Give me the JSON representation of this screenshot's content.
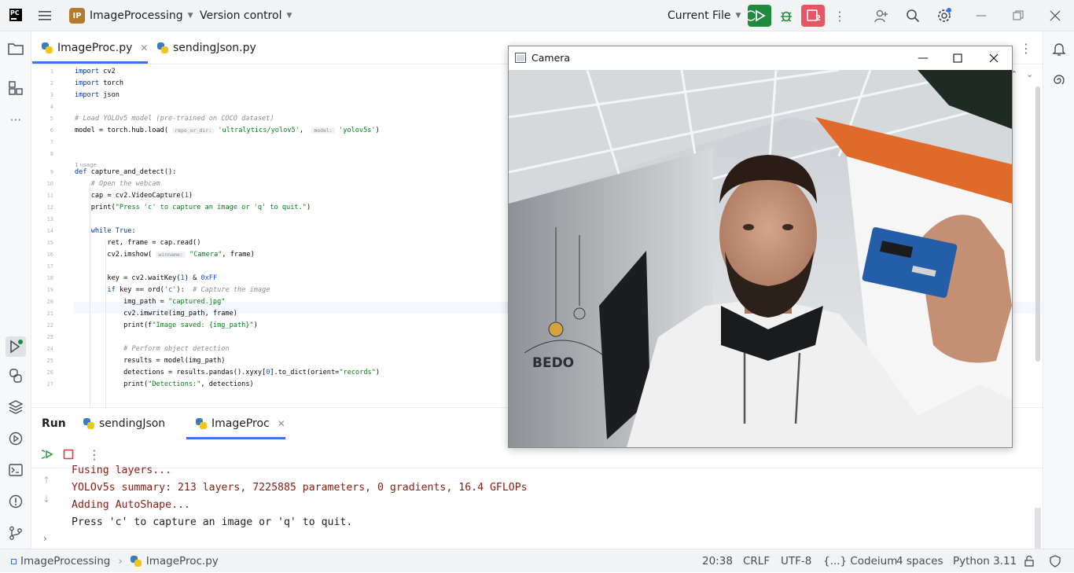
{
  "titlebar": {
    "app_logo": "PC",
    "project_badge": "IP",
    "project_name": "ImageProcessing",
    "vcs_label": "Version control",
    "run_config": "Current File",
    "stop_badge": "2"
  },
  "editor_tabs": [
    {
      "label": "ImageProc.py",
      "active": true
    },
    {
      "label": "sendingJson.py",
      "active": false
    }
  ],
  "code_lines": [
    {
      "n": "1",
      "text": "import cv2"
    },
    {
      "n": "2",
      "text": "import torch"
    },
    {
      "n": "3",
      "text": "import json"
    },
    {
      "n": "4",
      "text": ""
    },
    {
      "n": "5",
      "text": "# Load YOLOv5 model (pre-trained on COCO dataset)"
    },
    {
      "n": "6",
      "text": "model = torch.hub.load( repo_or_dir: 'ultralytics/yolov5',  model: 'yolov5s')"
    },
    {
      "n": "7",
      "text": ""
    },
    {
      "n": "8",
      "text": ""
    },
    {
      "n": "9",
      "text": "def capture_and_detect():"
    },
    {
      "n": "10",
      "text": "    # Open the webcam"
    },
    {
      "n": "11",
      "text": "    cap = cv2.VideoCapture(1)"
    },
    {
      "n": "12",
      "text": "    print(\"Press 'c' to capture an image or 'q' to quit.\")"
    },
    {
      "n": "13",
      "text": ""
    },
    {
      "n": "14",
      "text": "    while True:"
    },
    {
      "n": "15",
      "text": "        ret, frame = cap.read()"
    },
    {
      "n": "16",
      "text": "        cv2.imshow( winname: \"Camera\", frame)"
    },
    {
      "n": "17",
      "text": ""
    },
    {
      "n": "18",
      "text": "        key = cv2.waitKey(1) & 0xFF"
    },
    {
      "n": "19",
      "text": "        if key == ord('c'):  # Capture the image"
    },
    {
      "n": "20",
      "text": "            img_path = \"captured.jpg\""
    },
    {
      "n": "21",
      "text": "            cv2.imwrite(img_path, frame)"
    },
    {
      "n": "22",
      "text": "            print(f\"Image saved: {img_path}\")"
    },
    {
      "n": "23",
      "text": ""
    },
    {
      "n": "24",
      "text": "            # Perform object detection"
    },
    {
      "n": "25",
      "text": "            results = model(img_path)"
    },
    {
      "n": "26",
      "text": "            detections = results.pandas().xyxy[0].to_dict(orient=\"records\")"
    },
    {
      "n": "27",
      "text": "            print(\"Detections:\", detections)"
    }
  ],
  "usage_hint": "1 usage",
  "inlay_hints": {
    "repo": "repo_or_dir:",
    "model": "model:",
    "winname": "winname:"
  },
  "run_panel": {
    "title": "Run",
    "tabs": [
      {
        "label": "sendingJson",
        "active": false
      },
      {
        "label": "ImageProc",
        "active": true
      }
    ],
    "console": [
      {
        "text": "Fusing layers...",
        "type": "err"
      },
      {
        "text": "YOLOv5s summary: 213 layers, 7225885 parameters, 0 gradients, 16.4 GFLOPs",
        "type": "err"
      },
      {
        "text": "Adding AutoShape...",
        "type": "err"
      },
      {
        "text": "Press 'c' to capture an image or 'q' to quit.",
        "type": "out"
      }
    ]
  },
  "statusbar": {
    "breadcrumb_project": "ImageProcessing",
    "breadcrumb_file": "ImageProc.py",
    "caret": "20:38",
    "line_sep": "CRLF",
    "encoding": "UTF-8",
    "plugin": "{...} Codeium",
    "indent": "4 spaces",
    "interpreter": "Python 3.11"
  },
  "camera_window": {
    "title": "Camera",
    "photo_text_sign": "BEDO"
  },
  "colors": {
    "accent": "#3574f0",
    "run_green": "#208a3c",
    "stop_red": "#e55765",
    "console_err": "#8b1a10"
  }
}
